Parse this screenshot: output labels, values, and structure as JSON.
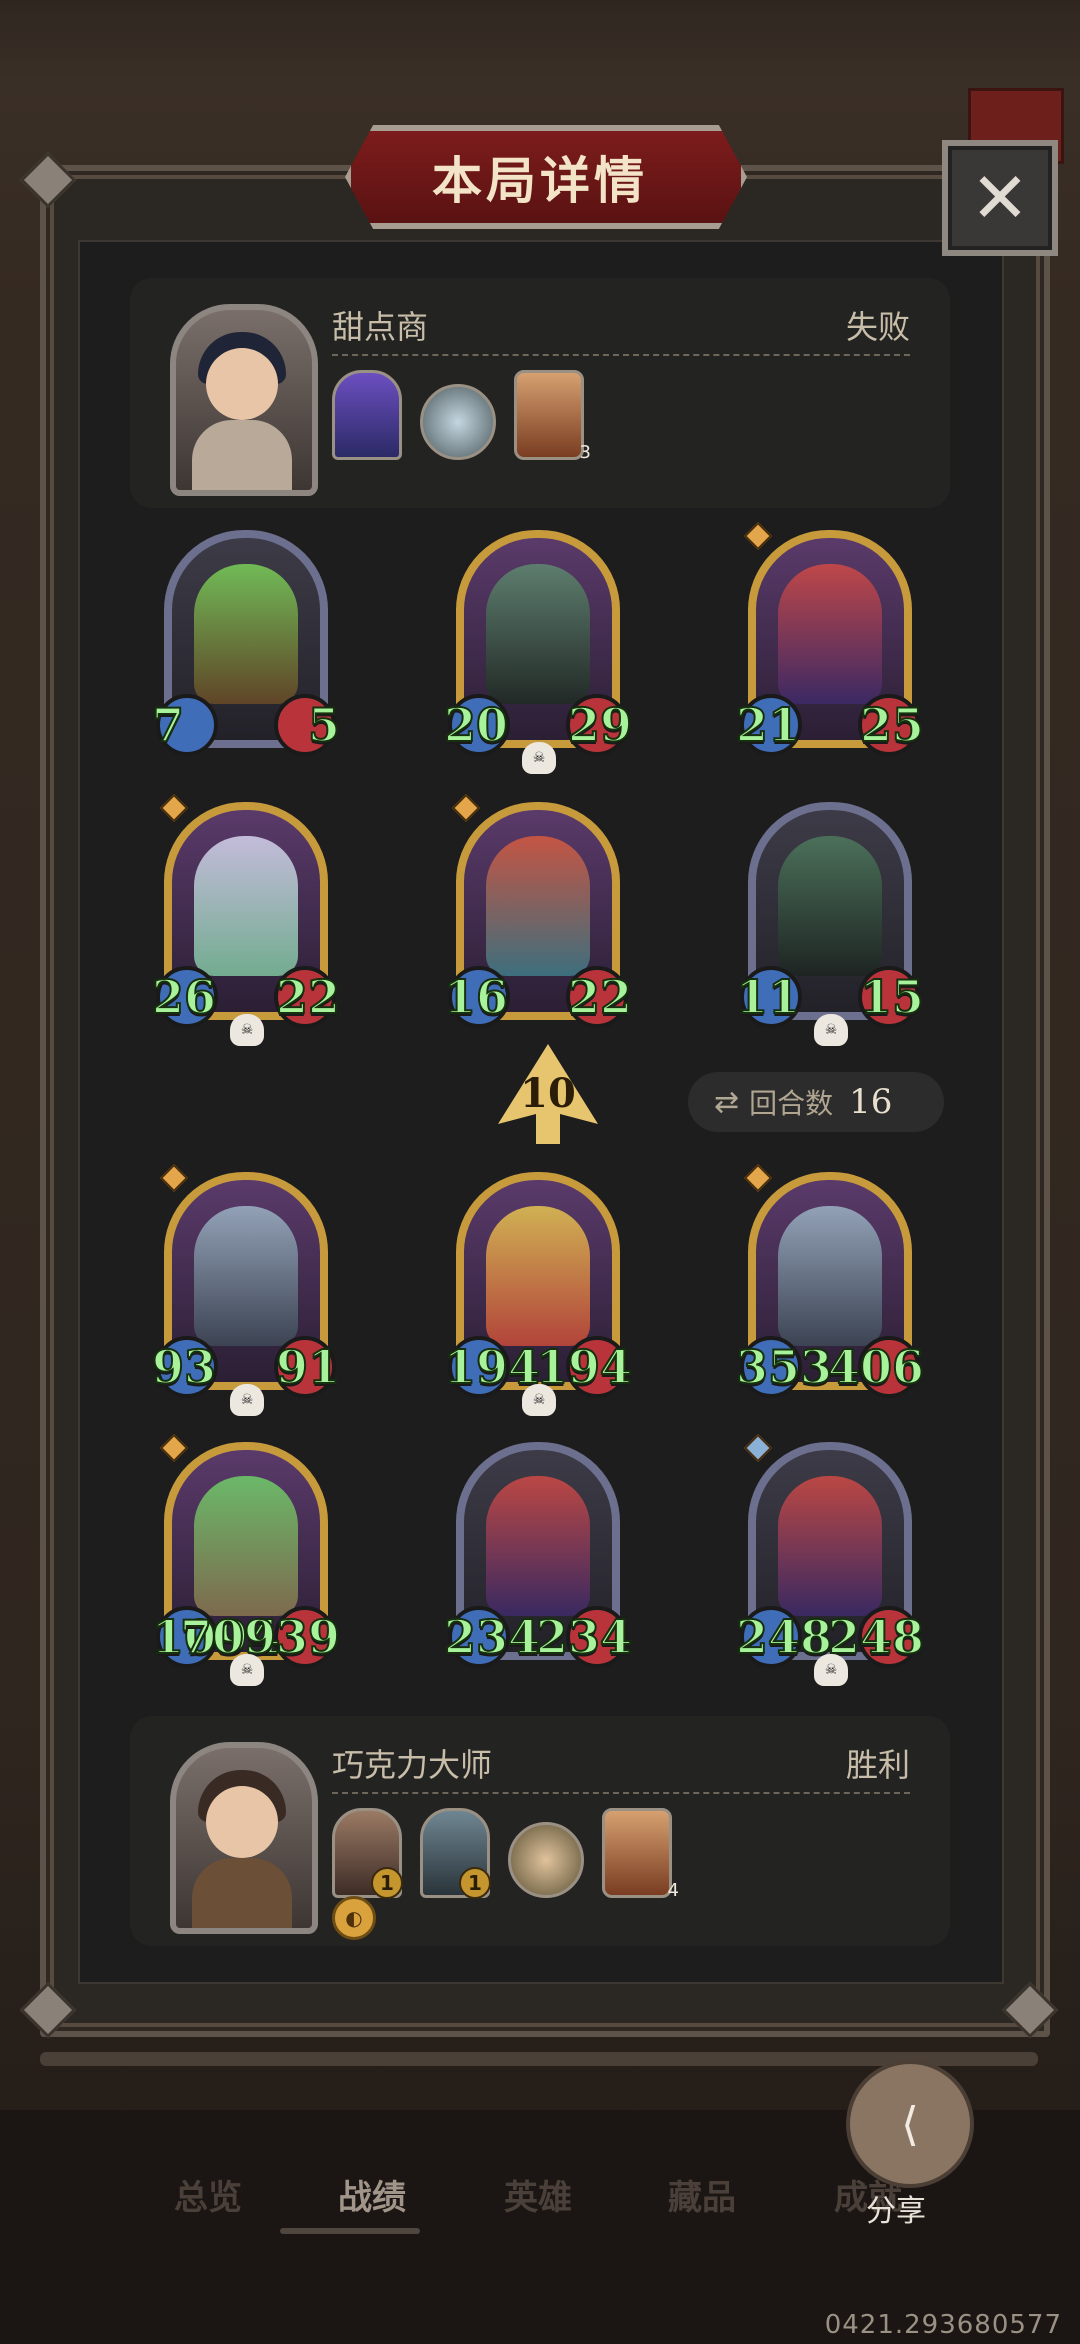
{
  "title": "本局详情",
  "close_label": "✕",
  "opponent": {
    "name": "甜点商",
    "result": "失败",
    "house_count": "3"
  },
  "player": {
    "name": "巧克力大师",
    "result": "胜利",
    "item1_count": "1",
    "item2_count": "1",
    "house_count": "4"
  },
  "opponent_board": [
    {
      "atk": "7",
      "hp": "5"
    },
    {
      "atk": "20",
      "hp": "29"
    },
    {
      "atk": "21",
      "hp": "25"
    },
    {
      "atk": "26",
      "hp": "22"
    },
    {
      "atk": "16",
      "hp": "22"
    },
    {
      "atk": "11",
      "hp": "15"
    }
  ],
  "player_board": [
    {
      "atk": "93",
      "hp": "91"
    },
    {
      "atk": "194",
      "hp": "194"
    },
    {
      "atk": "353",
      "hp": "406"
    },
    {
      "atk": "1094",
      "hp": "70939"
    },
    {
      "atk": "234",
      "hp": "234"
    },
    {
      "atk": "248",
      "hp": "248"
    }
  ],
  "round_level": "10",
  "turns": {
    "label": "回合数",
    "value": "16"
  },
  "nav": {
    "tab1": "总览",
    "tab2": "战绩",
    "tab3": "英雄",
    "tab4": "藏品",
    "tab5": "成就"
  },
  "share_label": "分享",
  "version": "0421.293680577",
  "colors": {
    "accent_red": "#7d1c1c",
    "gold_frame": "#c79a3c",
    "stat_green": "#a7f29a"
  }
}
